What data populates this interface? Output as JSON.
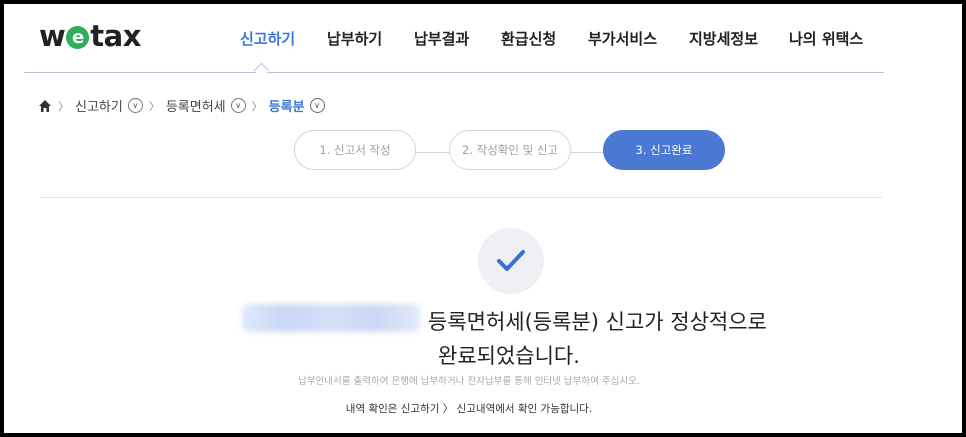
{
  "logo": {
    "pre": "w",
    "e": "e",
    "post": "tax"
  },
  "nav": [
    {
      "label": "신고하기",
      "active": true
    },
    {
      "label": "납부하기"
    },
    {
      "label": "납부결과"
    },
    {
      "label": "환급신청"
    },
    {
      "label": "부가서비스"
    },
    {
      "label": "지방세정보"
    },
    {
      "label": "나의 위택스"
    }
  ],
  "breadcrumb": {
    "level1": "신고하기",
    "level2": "등록면허세",
    "current": "등록분"
  },
  "steps": [
    "1. 신고서 작성",
    "2. 작성확인 및 신고",
    "3. 신고완료"
  ],
  "message": {
    "line1": "등록면허세(등록분) 신고가 정상적으로",
    "line2": "완료되었습니다."
  },
  "notes": {
    "info": "납부안내서를 출력하여 은행에 납부하거나 전자납부를 통해 인터넷 납부하여 주십시오.",
    "history": "내역 확인은 신고하기 〉 신고내역에서 확인 가능합니다."
  },
  "colors": {
    "accent": "#4a78d2",
    "logo_e": "#2fae5a"
  }
}
